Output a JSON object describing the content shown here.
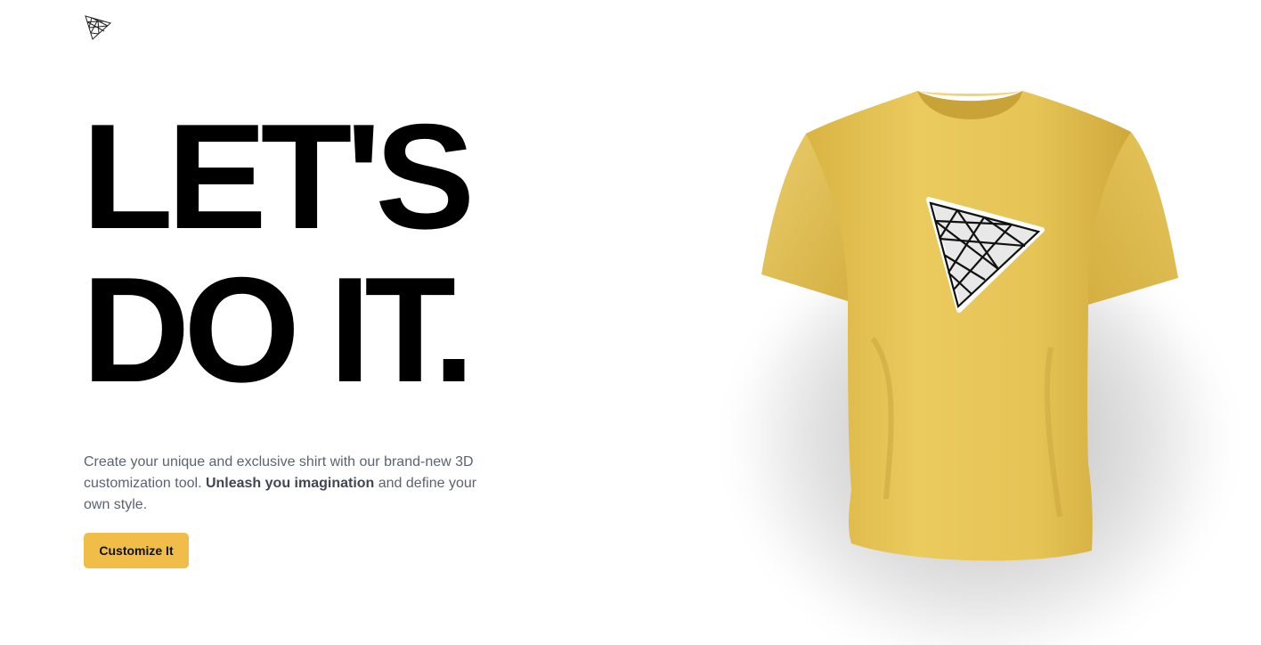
{
  "brand": {
    "logo_icon": "triangle-mesh-logo"
  },
  "hero": {
    "headline_line1": "LET'S",
    "headline_line2": "DO IT.",
    "description_part1": "Create your unique and exclusive shirt with our brand-new 3D customization tool. ",
    "description_bold": "Unleash you imagination",
    "description_part2": " and define your own style.",
    "cta_label": "Customize It"
  },
  "colors": {
    "accent": "#efbd48",
    "shirt": "#e8c55a",
    "text_muted": "#5b6372",
    "heading": "#000000"
  },
  "shirt": {
    "decal_icon": "triangle-mesh-decal"
  }
}
